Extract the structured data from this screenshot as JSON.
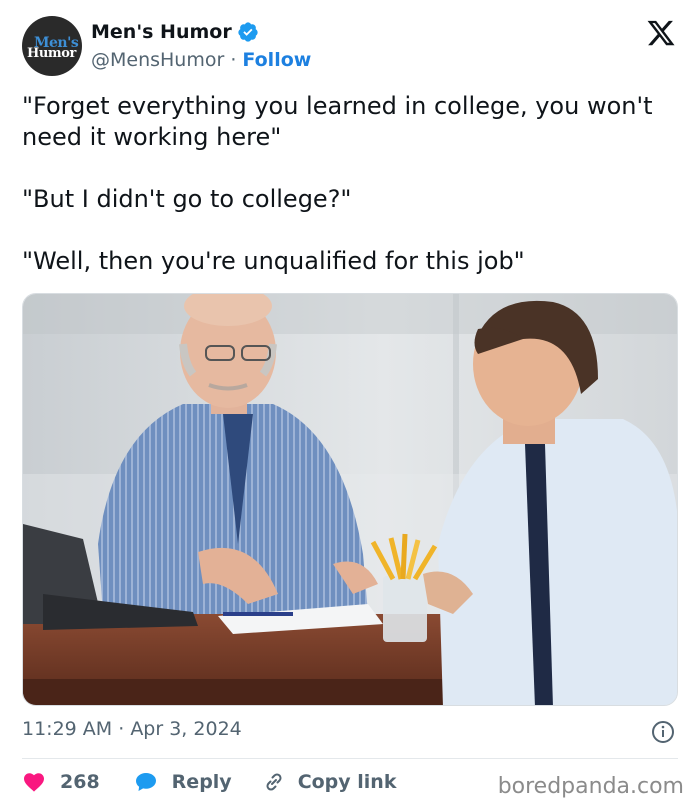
{
  "account": {
    "avatar_text_line1": "Men's",
    "avatar_text_line2": "Humor",
    "display_name": "Men's Humor",
    "handle": "@MensHumor",
    "separator": " · ",
    "follow_label": "Follow",
    "verified": true
  },
  "tweet": {
    "paragraphs": [
      "\"Forget everything you learned in college, you won't need it working here\"",
      "\"But I didn't go to college?\"",
      "\"Well, then you're unqualified for this job\""
    ],
    "time": "11:29 AM",
    "date_separator": " · ",
    "date": "Apr 3, 2024"
  },
  "actions": {
    "like_count": "268",
    "reply_label": "Reply",
    "copy_label": "Copy link"
  },
  "watermark": "boredpanda.com",
  "colors": {
    "accent": "#1d80e0",
    "like": "#f91880",
    "muted": "#536471"
  },
  "icons": [
    "verified-badge-icon",
    "x-logo-icon",
    "info-icon",
    "heart-icon",
    "reply-bubble-icon",
    "link-icon"
  ]
}
